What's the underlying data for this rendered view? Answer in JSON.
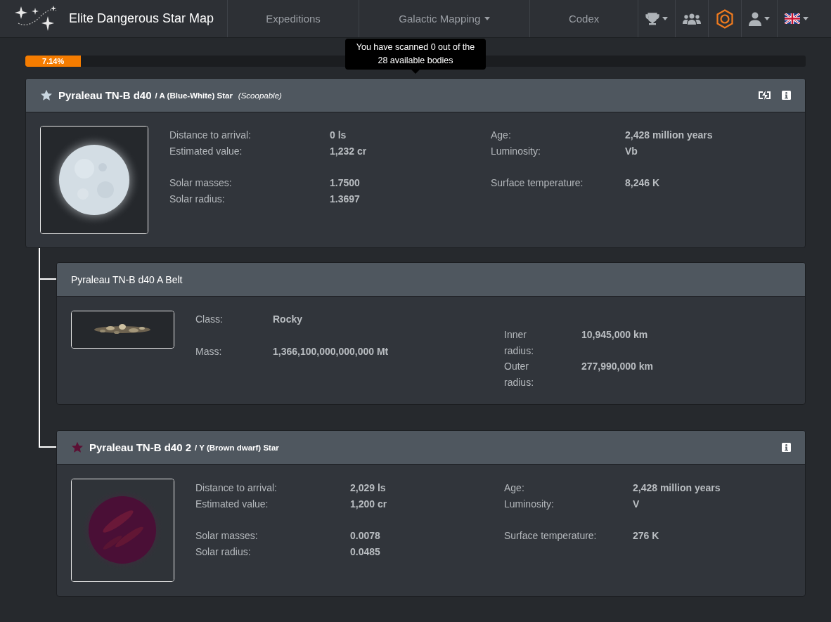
{
  "navbar": {
    "brand": "Elite Dangerous Star Map",
    "links": [
      {
        "label": "Expeditions",
        "dropdown": false
      },
      {
        "label": "Galactic Mapping",
        "dropdown": true
      },
      {
        "label": "Codex",
        "dropdown": false
      }
    ],
    "icon_buttons": [
      {
        "kind": "trophy",
        "dropdown": true
      },
      {
        "kind": "group",
        "dropdown": false
      },
      {
        "kind": "hexagon",
        "dropdown": false
      },
      {
        "kind": "user",
        "dropdown": true
      },
      {
        "kind": "flag",
        "dropdown": true
      }
    ]
  },
  "tooltip": "You have scanned 0 out of the 28 available bodies",
  "progress": {
    "level": 0.0714,
    "label": "7.14%"
  },
  "bodies": [
    {
      "kind": "star",
      "color": "#c9d6e0",
      "name": "Pyraleau TN-B d40",
      "subtitle": "/ A (Blue-White) Star",
      "note": "(Scoopable)",
      "scoopable": true,
      "left": [
        [
          {
            "label": "Distance to arrival:",
            "value": "0 ls"
          },
          {
            "label": "Estimated value:",
            "value": "1,232 cr"
          }
        ],
        [
          {
            "label": "Solar masses:",
            "value": "1.7500"
          },
          {
            "label": "Solar radius:",
            "value": "1.3697"
          }
        ]
      ],
      "right": [
        [
          {
            "label": "Age:",
            "value": "2,428 million years"
          },
          {
            "label": "Luminosity:",
            "value": "Vb"
          }
        ],
        [
          {
            "label": "Surface temperature:",
            "value": "8,246 K"
          }
        ]
      ],
      "children": [
        {
          "kind": "belt",
          "name": "Pyraleau TN-B d40 A Belt",
          "left": [
            [
              {
                "label": "Class:",
                "value": "Rocky"
              }
            ],
            [
              {
                "label": "Mass:",
                "value": "1,366,100,000,000,000 Mt"
              }
            ]
          ],
          "right": [
            [
              {
                "label": "Inner radius:",
                "value": "10,945,000 km"
              },
              {
                "label": "Outer radius:",
                "value": "277,990,000 km"
              }
            ]
          ]
        },
        {
          "kind": "star",
          "color": "#5c1034",
          "name": "Pyraleau TN-B d40 2",
          "subtitle": "/ Y (Brown dwarf) Star",
          "scoopable": false,
          "left": [
            [
              {
                "label": "Distance to arrival:",
                "value": "2,029 ls"
              },
              {
                "label": "Estimated value:",
                "value": "1,200 cr"
              }
            ],
            [
              {
                "label": "Solar masses:",
                "value": "0.0078"
              },
              {
                "label": "Solar radius:",
                "value": "0.0485"
              }
            ]
          ],
          "right": [
            [
              {
                "label": "Age:",
                "value": "2,428 million years"
              },
              {
                "label": "Luminosity:",
                "value": "V"
              }
            ],
            [
              {
                "label": "Surface temperature:",
                "value": "276 K"
              }
            ]
          ]
        }
      ]
    }
  ]
}
